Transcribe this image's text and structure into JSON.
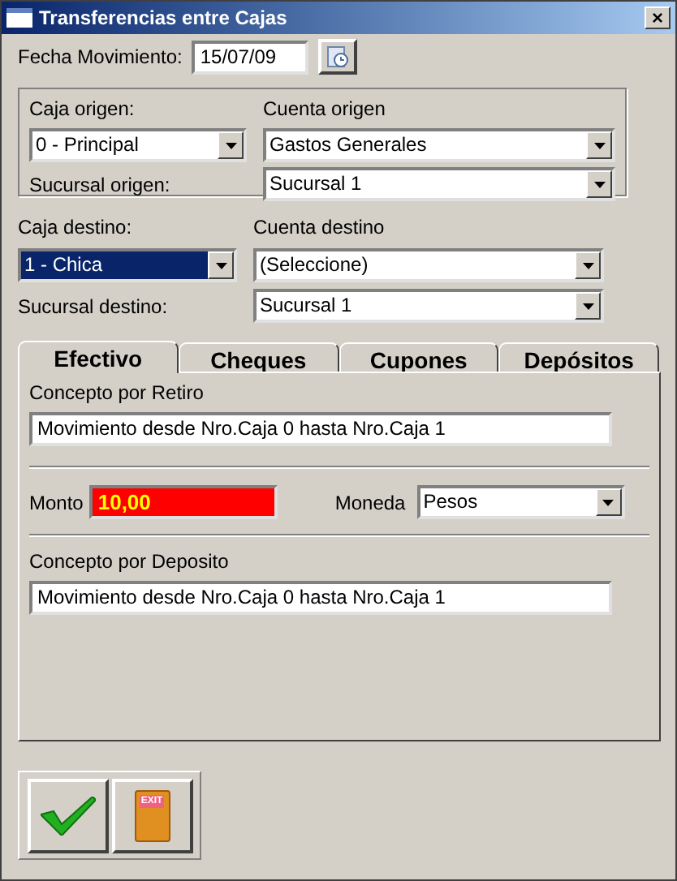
{
  "window": {
    "title": "Transferencias entre Cajas",
    "close": "×"
  },
  "fecha": {
    "label": "Fecha Movimiento:",
    "value": "15/07/09"
  },
  "origen": {
    "caja_label": "Caja origen:",
    "cuenta_label": "Cuenta origen",
    "caja": {
      "value": "0 - Principal",
      "selected": false
    },
    "cuenta": {
      "value": "Gastos Generales"
    },
    "sucursal_label": "Sucursal origen:",
    "sucursal": {
      "value": "Sucursal 1"
    }
  },
  "destino": {
    "caja_label": "Caja destino:",
    "cuenta_label": "Cuenta destino",
    "caja": {
      "value": "1 - Chica",
      "selected": true
    },
    "cuenta": {
      "value": "(Seleccione)"
    },
    "sucursal_label": "Sucursal destino:",
    "sucursal": {
      "value": "Sucursal 1"
    }
  },
  "tabs": [
    {
      "label": "Efectivo",
      "selected": true
    },
    {
      "label": "Cheques",
      "selected": false
    },
    {
      "label": "Cupones",
      "selected": false
    },
    {
      "label": "Depósitos",
      "selected": false
    }
  ],
  "efectivo": {
    "retiro_label": "Concepto por Retiro",
    "retiro_value": "Movimiento desde Nro.Caja 0 hasta Nro.Caja 1",
    "monto_label": "Monto",
    "monto_value": "10,00",
    "moneda_label": "Moneda",
    "moneda_value": "Pesos",
    "deposito_label": "Concepto por Deposito",
    "deposito_value": "Movimiento desde Nro.Caja 0 hasta Nro.Caja 1"
  },
  "buttons": [
    {
      "kind": "ok"
    },
    {
      "kind": "exit",
      "label": "EXIT"
    }
  ]
}
